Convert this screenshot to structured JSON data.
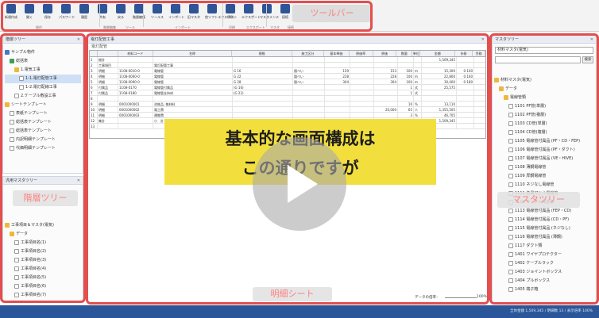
{
  "toolbar": {
    "buttons": [
      {
        "label": "新規作成",
        "icon": "new-document-icon"
      },
      {
        "label": "開く",
        "icon": "open-folder-icon"
      },
      {
        "label": "保存",
        "icon": "save-icon"
      },
      {
        "label": "パスワード",
        "icon": "key-icon"
      },
      {
        "label": "履歴",
        "icon": "history-icon"
      },
      {
        "label": "共有",
        "icon": "share-icon"
      },
      {
        "label": "戻る",
        "icon": "undo-icon"
      },
      {
        "label": "階層編集",
        "icon": "hierarchy-icon"
      },
      {
        "label": "ツールス",
        "icon": "tools-icon"
      },
      {
        "label": "インポート",
        "icon": "import-icon"
      },
      {
        "label": "旧マスタ",
        "icon": "master-icon"
      },
      {
        "label": "他ソフトエクスポート",
        "icon": "export-icon"
      },
      {
        "label": "印刷",
        "icon": "print-icon"
      },
      {
        "label": "エクスポート",
        "icon": "export-file-icon"
      },
      {
        "label": "マスタメンテ",
        "icon": "maintenance-icon"
      },
      {
        "label": "接続",
        "icon": "link-icon"
      }
    ],
    "groups": [
      "操作",
      "階層編集",
      "ツール",
      "インポート",
      "印刷",
      "エクスポート",
      "マスタ",
      "接続"
    ],
    "tag": "ツールバー"
  },
  "left_top_pane": {
    "title": "階層ツリー",
    "items": [
      {
        "label": "サンプル物件",
        "icon": "building-icon",
        "indent": 1
      },
      {
        "label": "総括表",
        "icon": "table-icon",
        "indent": 2
      },
      {
        "label": "1.電気工事",
        "icon": "folder-icon",
        "indent": 3
      },
      {
        "label": "1-1.電灯配管工事",
        "icon": "doc-icon",
        "indent": 4,
        "selected": true
      },
      {
        "label": "1-2.電灯配線工事",
        "icon": "doc-icon",
        "indent": 4
      },
      {
        "label": "2.ケーブル敷設工事",
        "icon": "doc-icon",
        "indent": 3
      },
      {
        "label": "シートテンプレート",
        "icon": "folder-icon",
        "indent": 1
      },
      {
        "label": "表紙テンプレート",
        "icon": "doc-icon",
        "indent": 2
      },
      {
        "label": "総括表テンプレート",
        "icon": "doc-icon",
        "indent": 2
      },
      {
        "label": "総括表テンプレート",
        "icon": "doc-icon",
        "indent": 2
      },
      {
        "label": "内訳明細テンプレート",
        "icon": "doc-icon",
        "indent": 2
      },
      {
        "label": "代価明細テンプレート",
        "icon": "doc-icon",
        "indent": 2
      }
    ],
    "tag": "階層ツリー"
  },
  "left_bottom_pane": {
    "title": "汎用マスタツリー",
    "items": [
      {
        "label": "工事項目＆マスタ(電気)",
        "icon": "folder-icon",
        "indent": 1
      },
      {
        "label": "データ",
        "icon": "folder-icon",
        "indent": 2
      },
      {
        "label": "工事項目名(1)",
        "icon": "doc-icon",
        "indent": 3
      },
      {
        "label": "工事項目名(2)",
        "icon": "doc-icon",
        "indent": 3
      },
      {
        "label": "工事項目名(3)",
        "icon": "doc-icon",
        "indent": 3
      },
      {
        "label": "工事項目名(4)",
        "icon": "doc-icon",
        "indent": 3
      },
      {
        "label": "工事項目名(5)",
        "icon": "doc-icon",
        "indent": 3
      },
      {
        "label": "工事項目名(6)",
        "icon": "doc-icon",
        "indent": 3
      },
      {
        "label": "工事項目名(7)",
        "icon": "doc-icon",
        "indent": 3
      },
      {
        "label": "工事項目名(8)",
        "icon": "doc-icon",
        "indent": 3
      },
      {
        "label": "工事項目名(9)",
        "icon": "doc-icon",
        "indent": 3
      }
    ]
  },
  "center_pane": {
    "tab": "電灯配管工事",
    "sheet_name": "電灯配管",
    "tag": "明細シート",
    "zoom_label": "データの倍率：",
    "zoom_value": "100%",
    "columns": [
      "",
      "",
      "材料コード",
      "名称",
      "規格",
      "施工区分",
      "基本単価",
      "原価率",
      "原価",
      "数量",
      "単位",
      "金額",
      "歩掛",
      "労務"
    ],
    "rows": [
      {
        "no": "1",
        "kind": "総計",
        "code": "",
        "name": "",
        "spec": "",
        "kubun": "",
        "unit_price": "",
        "rate": "",
        "qty": "",
        "unit": "",
        "cost": "",
        "amount": "1,509,345",
        "bugake": ""
      },
      {
        "no": "2",
        "kind": "工事項目",
        "code": "",
        "name": "電灯配管工事",
        "spec": "",
        "kubun": "",
        "unit_price": "",
        "rate": "",
        "qty": "",
        "unit": "",
        "cost": "",
        "amount": "",
        "bugake": ""
      },
      {
        "no": "3",
        "kind": "明細",
        "code": "1108-0010-0",
        "name": "電線管",
        "spec": "G 16",
        "kubun": "隠ぺい",
        "unit_price": "159",
        "rate": "",
        "qty": "100",
        "unit": "m",
        "cost": "153",
        "amount": "15,300",
        "bugake": "0.140"
      },
      {
        "no": "4",
        "kind": "明細",
        "code": "1108-0060-0",
        "name": "電線管",
        "spec": "G 22",
        "kubun": "隠ぺい",
        "unit_price": "228",
        "rate": "",
        "qty": "100",
        "unit": "m",
        "cost": "228",
        "amount": "22,800",
        "bugake": "0.160"
      },
      {
        "no": "5",
        "kind": "明細",
        "code": "1108-0090-0",
        "name": "電線管",
        "spec": "G 28",
        "kubun": "隠ぺい",
        "unit_price": "304",
        "rate": "",
        "qty": "100",
        "unit": "m",
        "cost": "304",
        "amount": "30,400",
        "bugake": "0.180"
      },
      {
        "no": "6",
        "kind": "付属品",
        "code": "1108-0170",
        "name": "電線管付属品",
        "spec": "(G 16)",
        "kubun": "",
        "unit_price": "",
        "rate": "",
        "qty": "1",
        "unit": "式",
        "cost": "",
        "amount": "25,575",
        "bugake": ""
      },
      {
        "no": "7",
        "kind": "付属品",
        "code": "1108-0180",
        "name": "電線管支持材",
        "spec": "(G 22)",
        "kubun": "",
        "unit_price": "",
        "rate": "",
        "qty": "1",
        "unit": "式",
        "cost": "",
        "amount": "",
        "bugake": ""
      },
      {
        "no": "8",
        "kind": "",
        "code": "",
        "name": "",
        "spec": "",
        "kubun": "",
        "unit_price": "",
        "rate": "",
        "qty": "",
        "unit": "",
        "cost": "",
        "amount": "",
        "bugake": ""
      },
      {
        "no": "9",
        "kind": "明細",
        "code": "0001000001",
        "name": "消耗品, 雑材料",
        "spec": "",
        "kubun": "",
        "unit_price": "",
        "rate": "",
        "qty": "10",
        "unit": "%",
        "cost": "",
        "amount": "13,110",
        "bugake": ""
      },
      {
        "no": "10",
        "kind": "明細",
        "code": "0001000002",
        "name": "電工費",
        "spec": "",
        "kubun": "",
        "unit_price": "",
        "rate": "",
        "qty": "65",
        "unit": "人",
        "cost": "20,000",
        "amount": "1,355,505",
        "bugake": ""
      },
      {
        "no": "11",
        "kind": "明細",
        "code": "0001000003",
        "name": "運搬費",
        "spec": "",
        "kubun": "",
        "unit_price": "",
        "rate": "",
        "qty": "3",
        "unit": "%",
        "cost": "",
        "amount": "46,705",
        "bugake": ""
      },
      {
        "no": "12",
        "kind": "集計",
        "code": "",
        "name": "小　計",
        "spec": "",
        "kubun": "",
        "unit_price": "",
        "rate": "",
        "qty": "",
        "unit": "",
        "cost": "",
        "amount": "1,509,345",
        "bugake": ""
      },
      {
        "no": "13",
        "kind": "",
        "code": "",
        "name": "",
        "spec": "",
        "kubun": "",
        "unit_price": "",
        "rate": "",
        "qty": "",
        "unit": "",
        "cost": "",
        "amount": "",
        "bugake": ""
      }
    ]
  },
  "right_pane": {
    "title": "マスタツリー",
    "selector": "材料マスタ(電気)",
    "search_label": "検索",
    "items": [
      {
        "label": "材料マスタ(電気)",
        "icon": "folder-icon",
        "indent": 1
      },
      {
        "label": "データ",
        "icon": "folder-icon",
        "indent": 2
      },
      {
        "label": "電線管類",
        "icon": "folder-icon",
        "indent": 3
      },
      {
        "label": "1101 PF管(単層)",
        "icon": "doc-icon",
        "indent": 4
      },
      {
        "label": "1102 PF管(複層)",
        "icon": "doc-icon",
        "indent": 4
      },
      {
        "label": "1103 CD管(単層)",
        "icon": "doc-icon",
        "indent": 4
      },
      {
        "label": "1104 CD管(複層)",
        "icon": "doc-icon",
        "indent": 4
      },
      {
        "label": "1105 電線管付属品 (PF・CD・FEP)",
        "icon": "doc-icon",
        "indent": 4
      },
      {
        "label": "1106 電線管付属品 (PF・ダクト)",
        "icon": "doc-icon",
        "indent": 4
      },
      {
        "label": "1107 電線管付属品 (VE・HIVE)",
        "icon": "doc-icon",
        "indent": 4
      },
      {
        "label": "1108 薄鋼電線管",
        "icon": "doc-icon",
        "indent": 4
      },
      {
        "label": "1109 厚鋼電線管",
        "icon": "doc-icon",
        "indent": 4
      },
      {
        "label": "1110 ネジなし電線管",
        "icon": "doc-icon",
        "indent": 4
      },
      {
        "label": "1111 金属可とう電線管",
        "icon": "doc-icon",
        "indent": 4
      },
      {
        "label": "1112 ケーブル保護管",
        "icon": "doc-icon",
        "indent": 4
      },
      {
        "label": "1113 電線管付属品 (FEP・CD)",
        "icon": "doc-icon",
        "indent": 4
      },
      {
        "label": "1114 電線管付属品 (CD・PF)",
        "icon": "doc-icon",
        "indent": 4
      },
      {
        "label": "1115 電線管付属品 (ネジなし)",
        "icon": "doc-icon",
        "indent": 4
      },
      {
        "label": "1116 電線管付属品 (薄鋼)",
        "icon": "doc-icon",
        "indent": 4
      },
      {
        "label": "1117 ダクト類",
        "icon": "doc-icon",
        "indent": 4
      },
      {
        "label": "1401 ワイヤプロテクター",
        "icon": "doc-icon",
        "indent": 4
      },
      {
        "label": "1402 ケーブルラック",
        "icon": "doc-icon",
        "indent": 4
      },
      {
        "label": "1403 ジョイントボックス",
        "icon": "doc-icon",
        "indent": 4
      },
      {
        "label": "1404 プルボックス",
        "icon": "doc-icon",
        "indent": 4
      },
      {
        "label": "1405 端子箱",
        "icon": "doc-icon",
        "indent": 4
      }
    ],
    "tag": "マスタツリー"
  },
  "caption": {
    "line1": "基本的な画面構成は",
    "line2": "この通りですが"
  },
  "status": "全体金額 1,509,345 / 明細数 13 / 表示倍率 100%"
}
